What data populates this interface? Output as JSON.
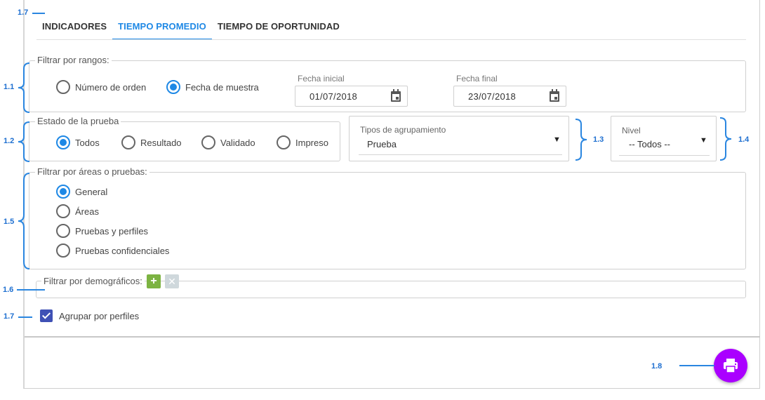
{
  "tabs": [
    {
      "label": "INDICADORES",
      "active": false
    },
    {
      "label": "TIEMPO PROMEDIO",
      "active": true
    },
    {
      "label": "TIEMPO DE OPORTUNIDAD",
      "active": false
    }
  ],
  "ranges": {
    "legend": "Filtrar por rangos:",
    "options": [
      {
        "label": "Número de orden",
        "checked": false
      },
      {
        "label": "Fecha de muestra",
        "checked": true
      }
    ],
    "start_label": "Fecha inicial",
    "start_value": "01/07/2018",
    "end_label": "Fecha final",
    "end_value": "23/07/2018"
  },
  "state": {
    "legend": "Estado de la prueba",
    "options": [
      {
        "label": "Todos",
        "checked": true
      },
      {
        "label": "Resultado",
        "checked": false
      },
      {
        "label": "Validado",
        "checked": false
      },
      {
        "label": "Impreso",
        "checked": false
      }
    ]
  },
  "grouping": {
    "label": "Tipos de agrupamiento",
    "value": "Prueba"
  },
  "level": {
    "label": "Nivel",
    "value": "-- Todos --"
  },
  "areas": {
    "legend": "Filtrar por áreas o pruebas:",
    "options": [
      {
        "label": "General",
        "checked": true
      },
      {
        "label": "Áreas",
        "checked": false
      },
      {
        "label": "Pruebas y perfiles",
        "checked": false
      },
      {
        "label": "Pruebas confidenciales",
        "checked": false
      }
    ]
  },
  "demographics": {
    "legend": "Filtrar por demográficos:",
    "add_symbol": "+",
    "clear_symbol": "✕"
  },
  "group_profiles": {
    "label": "Agrupar por perfiles",
    "checked": true
  },
  "print_button": {
    "icon": "printer-icon",
    "color": "#aa00ff"
  },
  "annotations": {
    "a17_top": "1.7",
    "a11": "1.1",
    "a12": "1.2",
    "a13": "1.3",
    "a14": "1.4",
    "a15": "1.5",
    "a16": "1.6",
    "a17_bottom": "1.7",
    "a18": "1.8"
  },
  "colors": {
    "accent": "#1e88e5",
    "annotation": "#1e6fd0",
    "add_button": "#7cb342",
    "checkbox": "#3f51b5"
  }
}
